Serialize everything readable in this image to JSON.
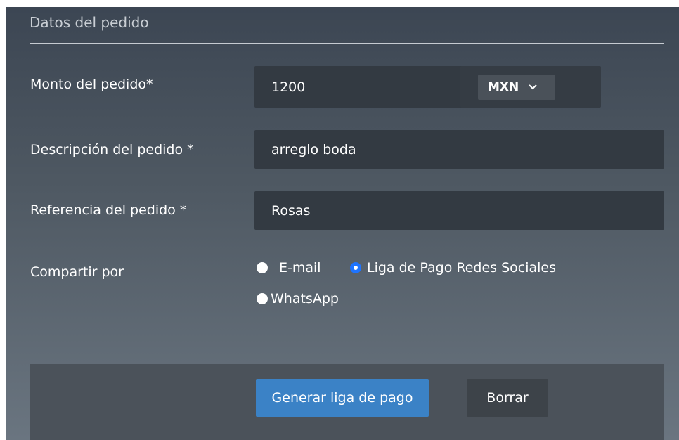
{
  "section": {
    "title": "Datos del pedido"
  },
  "form": {
    "amount": {
      "label": "Monto del pedido*",
      "value": "1200",
      "currency": "MXN"
    },
    "description": {
      "label": "Descripción del pedido *",
      "value": "arreglo boda"
    },
    "reference": {
      "label": "Referencia del pedido *",
      "value": "Rosas"
    },
    "share": {
      "label": "Compartir por",
      "options": [
        {
          "label": "E-mail",
          "checked": false
        },
        {
          "label": "Liga de Pago Redes Sociales",
          "checked": true
        },
        {
          "label": "WhatsApp",
          "checked": false
        }
      ]
    }
  },
  "buttons": {
    "generate": "Generar liga de pago",
    "clear": "Borrar"
  },
  "colors": {
    "accent": "#3b82c6",
    "radio_checked": "#1e74ff",
    "field_bg": "#333a42"
  }
}
